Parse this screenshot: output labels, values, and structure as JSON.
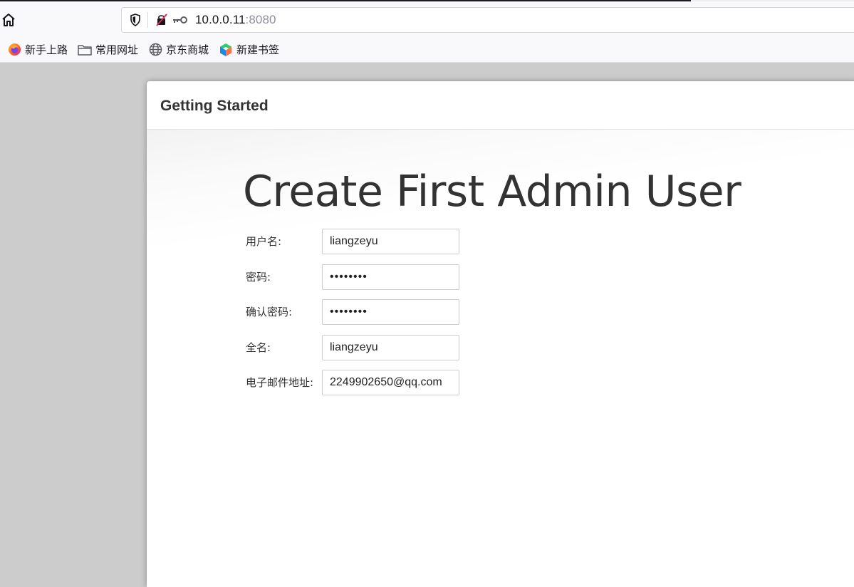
{
  "browser": {
    "url_host": "10.0.0.11",
    "url_port": ":8080",
    "bookmarks": [
      {
        "label": "新手上路",
        "icon": "firefox-icon"
      },
      {
        "label": "常用网址",
        "icon": "folder-icon"
      },
      {
        "label": "京东商城",
        "icon": "globe-icon"
      },
      {
        "label": "新建书签",
        "icon": "cube-logo-icon"
      }
    ]
  },
  "dialog": {
    "title": "Getting Started",
    "heading": "Create First Admin User",
    "fields": {
      "username": {
        "label": "用户名:",
        "value": "liangzeyu"
      },
      "password": {
        "label": "密码:",
        "value": "********"
      },
      "confirm_password": {
        "label": "确认密码:",
        "value": "********"
      },
      "fullname": {
        "label": "全名:",
        "value": "liangzeyu"
      },
      "email": {
        "label": "电子邮件地址:",
        "value": "2249902650@qq.com"
      }
    }
  },
  "colors": {
    "page_background": "#cccccc",
    "heading_text": "#333333",
    "input_border": "#cccccc"
  }
}
